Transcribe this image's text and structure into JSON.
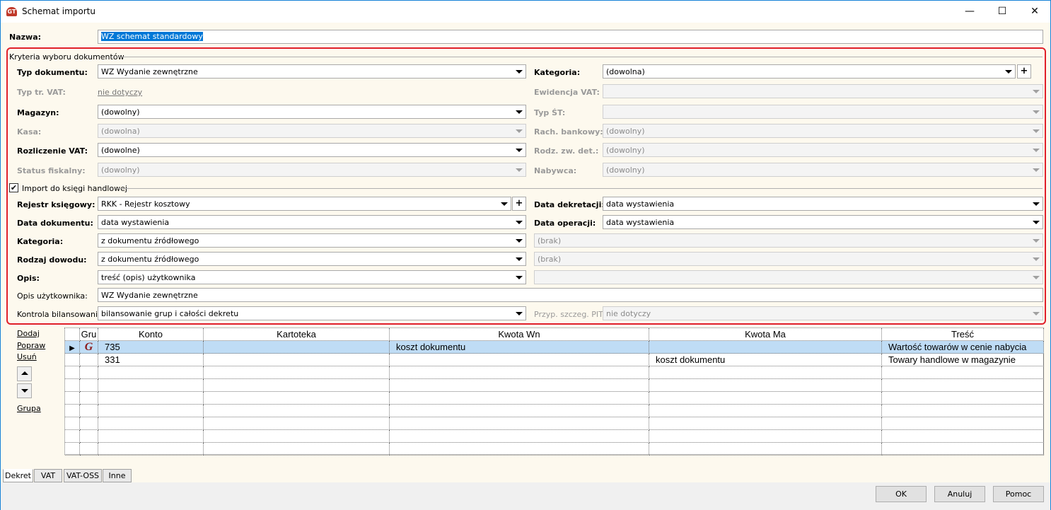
{
  "window": {
    "title": "Schemat importu",
    "minimize": "—",
    "maximize": "☐",
    "close": "✕"
  },
  "nazwa": {
    "label": "Nazwa:",
    "value": "WZ schemat standardowy"
  },
  "criteria": {
    "title": "Kryteria wyboru dokumentów",
    "typ_dokumentu": {
      "label": "Typ dokumentu:",
      "value": "WZ Wydanie zewnętrzne"
    },
    "kategoria": {
      "label": "Kategoria:",
      "value": "(dowolna)"
    },
    "typ_tr_vat": {
      "label": "Typ tr. VAT:",
      "value": "nie dotyczy"
    },
    "ewidencja_vat": {
      "label": "Ewidencja VAT:",
      "value": ""
    },
    "magazyn": {
      "label": "Magazyn:",
      "value": "(dowolny)"
    },
    "typ_st": {
      "label": "Typ ŚT:",
      "value": ""
    },
    "kasa": {
      "label": "Kasa:",
      "value": "(dowolna)"
    },
    "rach_bankowy": {
      "label": "Rach. bankowy:",
      "value": "(dowolny)"
    },
    "rozliczenie_vat": {
      "label": "Rozliczenie VAT:",
      "value": "(dowolne)"
    },
    "rodz_zw_det": {
      "label": "Rodz. zw. det.:",
      "value": "(dowolny)"
    },
    "status_fiskalny": {
      "label": "Status fiskalny:",
      "value": "(dowolny)"
    },
    "nabywca": {
      "label": "Nabywca:",
      "value": "(dowolny)"
    }
  },
  "import": {
    "label": "Import do księgi handlowej",
    "checked": true,
    "rejestr": {
      "label": "Rejestr księgowy:",
      "value": "RKK - Rejestr kosztowy"
    },
    "data_dekretacji": {
      "label": "Data dekretacji:",
      "value": "data wystawienia"
    },
    "data_dokumentu": {
      "label": "Data dokumentu:",
      "value": "data wystawienia"
    },
    "data_operacji": {
      "label": "Data operacji:",
      "value": "data wystawienia"
    },
    "kategoria": {
      "label": "Kategoria:",
      "value": "z dokumentu źródłowego"
    },
    "kategoria2": {
      "value": "(brak)"
    },
    "rodzaj_dowodu": {
      "label": "Rodzaj dowodu:",
      "value": "z dokumentu źródłowego"
    },
    "rodzaj2": {
      "value": "(brak)"
    },
    "opis": {
      "label": "Opis:",
      "value": "treść (opis) użytkownika"
    },
    "opis2": {
      "value": ""
    },
    "opis_uzytkownika": {
      "label": "Opis użytkownika:",
      "value": "WZ Wydanie zewnętrzne"
    },
    "kontrola": {
      "label": "Kontrola bilansowania:",
      "value": "bilansowanie grup i całości dekretu"
    },
    "przyp_pit": {
      "label": "Przyp. szczeg. PIT:",
      "value": "nie dotyczy"
    }
  },
  "side": {
    "dodaj": "Dodaj",
    "popraw": "Popraw",
    "usun": "Usuń",
    "grupa": "Grupa"
  },
  "grid": {
    "columns": [
      "",
      "Gru",
      "Konto",
      "Kartoteka",
      "Kwota Wn",
      "Kwota Ma",
      "Treść"
    ],
    "rows": [
      [
        "▶",
        "G",
        "735",
        "",
        "koszt dokumentu",
        "",
        "Wartość towarów w cenie nabycia"
      ],
      [
        "",
        "",
        "331",
        "",
        "",
        "koszt dokumentu",
        "Towary handlowe w magazynie"
      ]
    ]
  },
  "tabs": [
    "Dekret",
    "VAT",
    "VAT-OSS",
    "Inne"
  ],
  "buttons": {
    "ok": "OK",
    "cancel": "Anuluj",
    "help": "Pomoc"
  }
}
